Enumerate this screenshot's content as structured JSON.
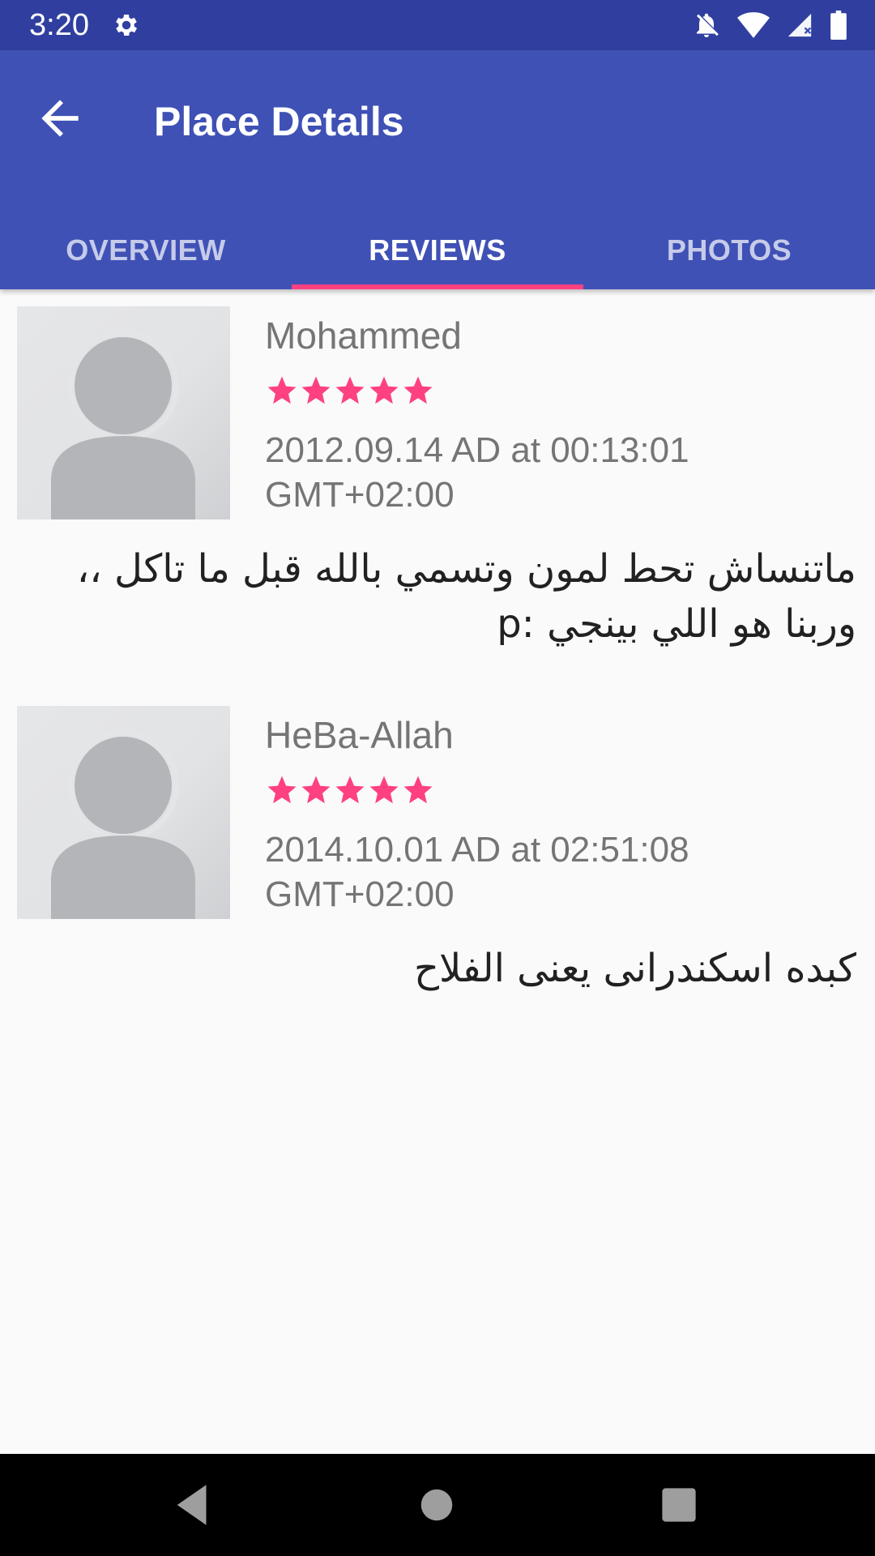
{
  "status_bar": {
    "time": "3:20",
    "icons": [
      "gear-icon",
      "notifications-off-icon",
      "wifi-icon",
      "cell-signal-icon",
      "battery-icon"
    ]
  },
  "app_bar": {
    "title": "Place Details",
    "back_icon": "arrow-back-icon",
    "background": "#3f51b5",
    "status_background": "#303f9f"
  },
  "tabs": [
    {
      "label": "OVERVIEW",
      "active": false
    },
    {
      "label": "REVIEWS",
      "active": true
    },
    {
      "label": "PHOTOS",
      "active": false
    }
  ],
  "tab_indicator_color": "#ff4081",
  "reviews": [
    {
      "author": "Mohammed",
      "rating": 5,
      "date": "2012.09.14 AD at 00:13:01 GMT+02:00",
      "text": "ماتنساش تحط لمون وتسمي بالله قبل ما تاكل ،، وربنا هو اللي بينجي :p"
    },
    {
      "author": "HeBa-Allah",
      "rating": 5,
      "date": "2014.10.01 AD at 02:51:08 GMT+02:00",
      "text": "كبده اسكندرانى يعنى الفلاح"
    }
  ],
  "star_color": "#ff4081",
  "nav_bar": {
    "icons": [
      "back-triangle-icon",
      "home-circle-icon",
      "recents-square-icon"
    ]
  }
}
